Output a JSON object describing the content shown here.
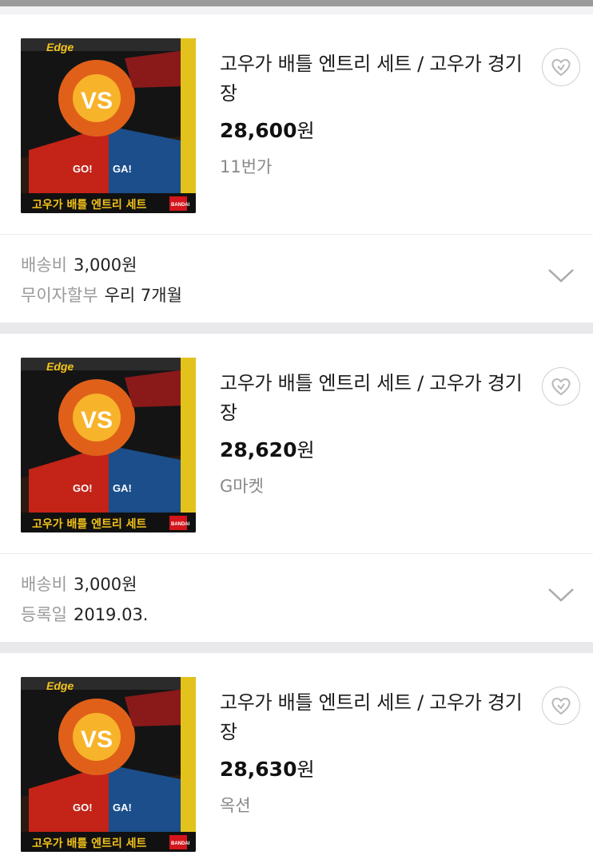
{
  "products": [
    {
      "title": "고우가 배틀 엔트리 세트 / 고우가 경기장",
      "price": "28,600",
      "price_unit": "원",
      "seller": "11번가",
      "meta": [
        {
          "label": "배송비",
          "value": "3,000원"
        },
        {
          "label": "무이자할부",
          "value": "우리 7개월"
        }
      ]
    },
    {
      "title": "고우가 배틀 엔트리 세트 / 고우가 경기장",
      "price": "28,620",
      "price_unit": "원",
      "seller": "G마켓",
      "meta": [
        {
          "label": "배송비",
          "value": "3,000원"
        },
        {
          "label": "등록일",
          "value": "2019.03."
        }
      ]
    },
    {
      "title": "고우가 배틀 엔트리 세트 / 고우가 경기장",
      "price": "28,630",
      "price_unit": "원",
      "seller": "옥션"
    }
  ],
  "thumbnail": {
    "box_text": "고우가 배틀 엔트리 세트",
    "vs_text": "VS",
    "go_text": "GO!",
    "ga_text": "GA!",
    "brand_text": "BANDAI",
    "logo_text": "Edge"
  },
  "colors": {
    "price": "#111111",
    "seller": "#888888",
    "meta_label": "#9a9a9a",
    "section_gap": "#e9e9ec"
  }
}
